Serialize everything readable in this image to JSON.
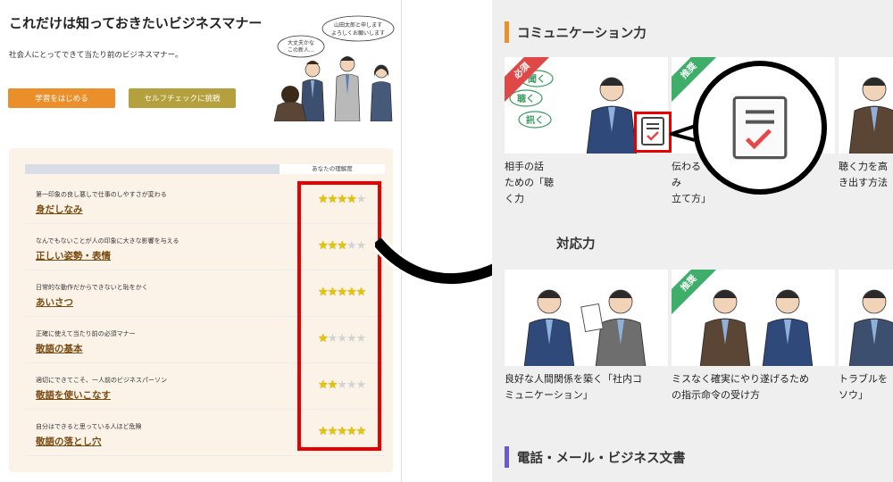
{
  "left": {
    "title": "これだけは知っておきたいビジネスマナー",
    "subtitle": "社会人にとってできて当たり前のビジネスマナー。",
    "start_button": "学習をはじめる",
    "check_button": "セルフチェックに挑戦",
    "bubble_left": "大丈夫かな\nこの新人…",
    "bubble_right": "山田太郎と申します\nよろしくお願いします",
    "panel_header": "あなたの理解度",
    "rows": [
      {
        "desc": "第一印象の良し悪しで仕事のしやすさが変わる",
        "link": "身だしなみ",
        "stars": 4
      },
      {
        "desc": "なんでもないことが人の印象に大きな影響を与える",
        "link": "正しい姿勢・表情",
        "stars": 3
      },
      {
        "desc": "日常的な動作だからできないと恥をかく",
        "link": "あいさつ",
        "stars": 5
      },
      {
        "desc": "正確に使えて当たり前の必須マナー",
        "link": "敬語の基本",
        "stars": 1
      },
      {
        "desc": "適切にできてこそ、一人前のビジネスパーソン",
        "link": "敬語を使いこなす",
        "stars": 2
      },
      {
        "desc": "自分はできると思っている人ほど危険",
        "link": "敬語の落とし穴",
        "stars": 5
      }
    ]
  },
  "right": {
    "sections": [
      {
        "title": "コミュニケーション力",
        "color": "#ea8f2a"
      },
      {
        "title": "対応力",
        "color": "#e0e0e0"
      },
      {
        "title": "電話・メール・ビジネス文書",
        "color": "#6a5acd"
      }
    ],
    "row1": [
      {
        "badge": "必須",
        "badge_color": "#e04848",
        "caption": "相手の話を…ための「聴く力」",
        "speech": [
          "聞く",
          "聴く",
          "訊く"
        ]
      },
      {
        "badge": "推奨",
        "badge_color": "#3fae6a",
        "caption": "伝わる…み立て方」"
      },
      {
        "badge": "",
        "badge_color": "",
        "caption": "聴く力を高き出す方法"
      }
    ],
    "row1_captions": [
      [
        "相手の話",
        "ための「聴",
        "く力"
      ],
      [
        "伝わる",
        "み",
        "立て方」"
      ],
      [
        "聴く力を高",
        "き出す方法"
      ]
    ],
    "row2": [
      {
        "badge": "",
        "badge_color": "",
        "caption": "良好な人間関係を築く「社内コミュニケーション」"
      },
      {
        "badge": "推奨",
        "badge_color": "#3fae6a",
        "caption": "ミスなく確実にやり遂げるための指示命令の受け方"
      },
      {
        "badge": "",
        "badge_color": "",
        "caption": "トラブルをソウ」"
      }
    ],
    "row2_captions": [
      [
        "良好な人間関係を築く「社内コ",
        "ミュニケーション」"
      ],
      [
        "ミスなく確実にやり遂げるため",
        "の指示命令の受け方"
      ],
      [
        "トラブルを",
        "ソウ」"
      ]
    ]
  },
  "colors": {
    "highlight": "#e60000",
    "star_on": "#e7c400",
    "star_off": "#d3d3d3",
    "link": "#7a4b12",
    "check": "#e8474a"
  }
}
